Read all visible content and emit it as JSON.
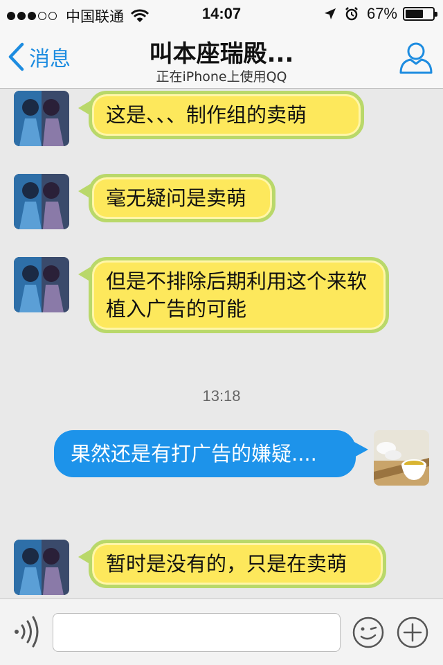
{
  "status_bar": {
    "carrier": "中国联通",
    "time": "14:07",
    "battery_percent": "67%",
    "battery_level": 0.67,
    "signal_bars_filled": 3,
    "signal_bars_total": 5
  },
  "nav": {
    "back_label": "消息",
    "title": "叫本座瑞殿...",
    "subtitle": "正在iPhone上使用QQ",
    "accent_color": "#1d8ce0"
  },
  "messages": [
    {
      "side": "incoming",
      "text": "这是、、、制作组的卖萌"
    },
    {
      "side": "incoming",
      "text": "毫无疑问是卖萌"
    },
    {
      "side": "incoming",
      "text": "但是不排除后期利用这个来软植入广告的可能"
    },
    {
      "side": "outgoing",
      "text": "果然还是有打广告的嫌疑...."
    },
    {
      "side": "incoming",
      "text": "暂时是没有的，只是在卖萌"
    }
  ],
  "timestamp": "13:18",
  "colors": {
    "incoming_bubble": "#fde85c",
    "incoming_border": "#b9d86a",
    "outgoing_bubble": "#1d93ea",
    "background": "#e9e9e9"
  },
  "input_bar": {
    "text_value": "",
    "placeholder": ""
  },
  "icons": {
    "back": "chevron-left-icon",
    "contact": "user-profile-icon",
    "voice": "voice-input-icon",
    "emoji": "emoji-icon",
    "more": "plus-icon"
  }
}
